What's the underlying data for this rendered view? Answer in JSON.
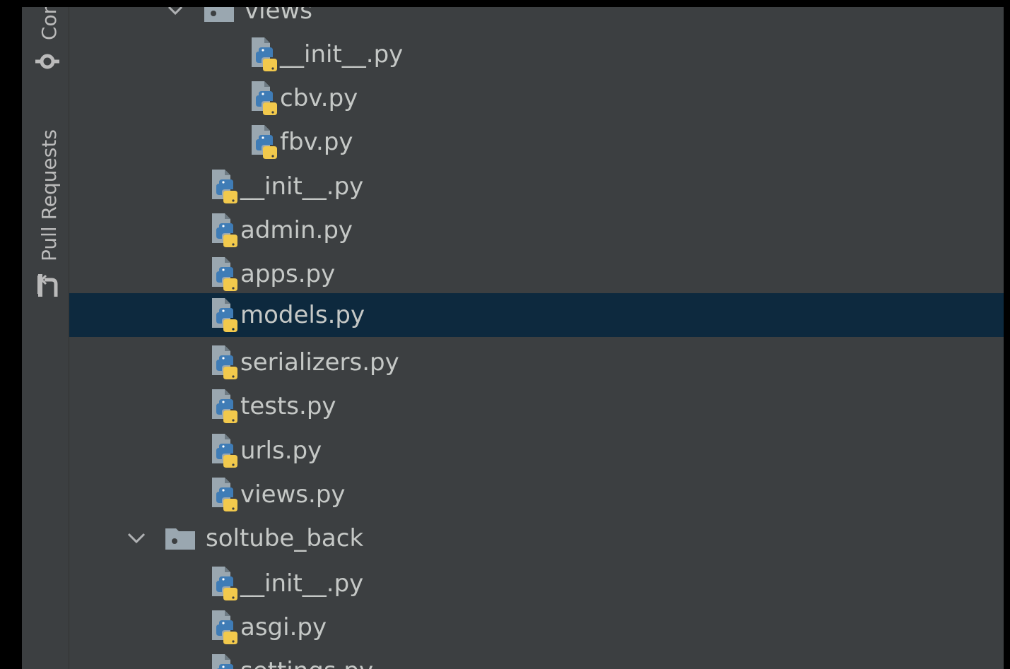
{
  "tool_window_tabs": [
    {
      "label": "Commit",
      "icon": "commit-icon"
    },
    {
      "label": "Pull Requests",
      "icon": "pull-request-icon"
    }
  ],
  "tree": {
    "items": [
      {
        "name": "views",
        "kind": "folder",
        "expanded": true,
        "depth": 2
      },
      {
        "name": "__init__.py",
        "kind": "python-file",
        "depth": 3
      },
      {
        "name": "cbv.py",
        "kind": "python-file",
        "depth": 3
      },
      {
        "name": "fbv.py",
        "kind": "python-file",
        "depth": 3
      },
      {
        "name": "__init__.py",
        "kind": "python-file",
        "depth": 2
      },
      {
        "name": "admin.py",
        "kind": "python-file",
        "depth": 2
      },
      {
        "name": "apps.py",
        "kind": "python-file",
        "depth": 2
      },
      {
        "name": "models.py",
        "kind": "python-file",
        "depth": 2,
        "selected": true
      },
      {
        "name": "serializers.py",
        "kind": "python-file",
        "depth": 2
      },
      {
        "name": "tests.py",
        "kind": "python-file",
        "depth": 2
      },
      {
        "name": "urls.py",
        "kind": "python-file",
        "depth": 2
      },
      {
        "name": "views.py",
        "kind": "python-file",
        "depth": 2
      },
      {
        "name": "soltube_back",
        "kind": "folder",
        "expanded": true,
        "depth": 1
      },
      {
        "name": "__init__.py",
        "kind": "python-file",
        "depth": 2
      },
      {
        "name": "asgi.py",
        "kind": "python-file",
        "depth": 2
      },
      {
        "name": "settings.py",
        "kind": "python-file",
        "depth": 2
      }
    ]
  },
  "colors": {
    "panel_bg": "#3c3f41",
    "selection_bg": "#0d293e",
    "text": "#c5c8c6",
    "python_blue": "#3f7cb6",
    "python_yellow": "#f2c94c"
  }
}
